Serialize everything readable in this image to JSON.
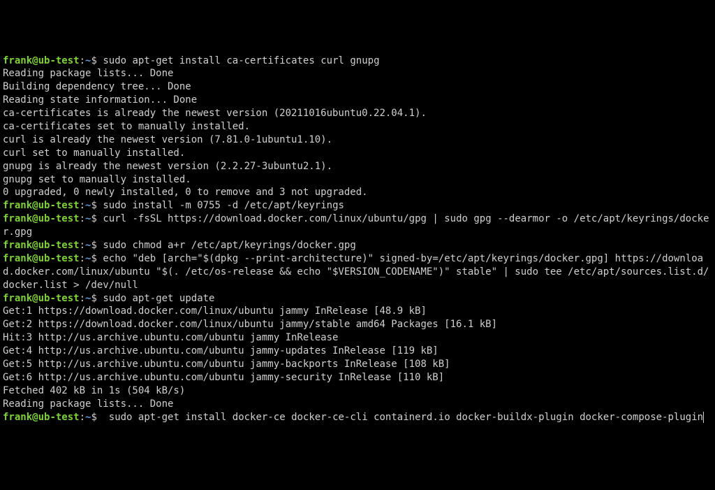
{
  "prompt": {
    "user": "frank",
    "at": "@",
    "host": "ub-test",
    "colon": ":",
    "path": "~",
    "dollar": "$"
  },
  "entries": [
    {
      "type": "cmd",
      "text": "sudo apt-get install ca-certificates curl gnupg"
    },
    {
      "type": "out",
      "text": "Reading package lists... Done"
    },
    {
      "type": "out",
      "text": "Building dependency tree... Done"
    },
    {
      "type": "out",
      "text": "Reading state information... Done"
    },
    {
      "type": "out",
      "text": "ca-certificates is already the newest version (20211016ubuntu0.22.04.1)."
    },
    {
      "type": "out",
      "text": "ca-certificates set to manually installed."
    },
    {
      "type": "out",
      "text": "curl is already the newest version (7.81.0-1ubuntu1.10)."
    },
    {
      "type": "out",
      "text": "curl set to manually installed."
    },
    {
      "type": "out",
      "text": "gnupg is already the newest version (2.2.27-3ubuntu2.1)."
    },
    {
      "type": "out",
      "text": "gnupg set to manually installed."
    },
    {
      "type": "out",
      "text": "0 upgraded, 0 newly installed, 0 to remove and 3 not upgraded."
    },
    {
      "type": "cmd",
      "text": "sudo install -m 0755 -d /etc/apt/keyrings"
    },
    {
      "type": "cmd",
      "text": "curl -fsSL https://download.docker.com/linux/ubuntu/gpg | sudo gpg --dearmor -o /etc/apt/keyrings/docker.gpg"
    },
    {
      "type": "cmd",
      "text": "sudo chmod a+r /etc/apt/keyrings/docker.gpg"
    },
    {
      "type": "cmd",
      "text": "echo \"deb [arch=\"$(dpkg --print-architecture)\" signed-by=/etc/apt/keyrings/docker.gpg] https://download.docker.com/linux/ubuntu \"$(. /etc/os-release && echo \"$VERSION_CODENAME\")\" stable\" | sudo tee /etc/apt/sources.list.d/docker.list > /dev/null"
    },
    {
      "type": "cmd",
      "text": "sudo apt-get update"
    },
    {
      "type": "out",
      "text": "Get:1 https://download.docker.com/linux/ubuntu jammy InRelease [48.9 kB]"
    },
    {
      "type": "out",
      "text": "Get:2 https://download.docker.com/linux/ubuntu jammy/stable amd64 Packages [16.1 kB]"
    },
    {
      "type": "out",
      "text": "Hit:3 http://us.archive.ubuntu.com/ubuntu jammy InRelease"
    },
    {
      "type": "out",
      "text": "Get:4 http://us.archive.ubuntu.com/ubuntu jammy-updates InRelease [119 kB]"
    },
    {
      "type": "out",
      "text": "Get:5 http://us.archive.ubuntu.com/ubuntu jammy-backports InRelease [108 kB]"
    },
    {
      "type": "out",
      "text": "Get:6 http://us.archive.ubuntu.com/ubuntu jammy-security InRelease [110 kB]"
    },
    {
      "type": "out",
      "text": "Fetched 402 kB in 1s (504 kB/s)"
    },
    {
      "type": "out",
      "text": "Reading package lists... Done"
    },
    {
      "type": "cmd",
      "text": " sudo apt-get install docker-ce docker-ce-cli containerd.io docker-buildx-plugin docker-compose-plugin",
      "cursor": true
    }
  ]
}
